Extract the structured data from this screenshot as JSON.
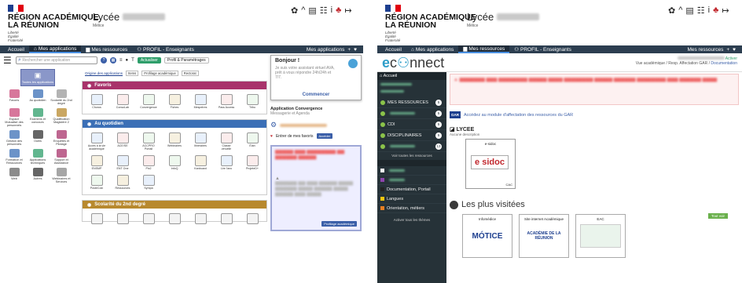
{
  "left": {
    "header": {
      "ministry": "RÉGION ACADÉMIQUE\nLA RÉUNION",
      "motto": "Liberté\nÉgalité\nFraternité",
      "school": "Lycée",
      "subtitle": "Mélice"
    },
    "nav": {
      "home": "Accueil",
      "apps": "Mes applications",
      "resources": "Mes ressources",
      "profile": "PROFIL - Enseignants",
      "right": "Mes applications"
    },
    "toolbar": {
      "search_placeholder": "Rechercher une application",
      "refresh": "Actualiser",
      "profile_settings": "Profil & Paramétrages"
    },
    "sidebar": {
      "selected": "Toutes les applications",
      "items": [
        "Favoris",
        "Au quotidien",
        "Scolarité du 2nd degré",
        "Espace Mutualisé des personnels",
        "Examens et concours",
        "Qualification Magistère 2",
        "Gestion des personnels",
        "Outils",
        "Enquêtes et Pilotage",
        "Formation et Ressources",
        "Applications techniques",
        "Support et Assistance",
        "Web",
        "Autres",
        "Webinaires et Services"
      ]
    },
    "origin": {
      "label": "Origine des applications",
      "chips": [
        "Items",
        "Profilage académique",
        "Rectorat"
      ]
    },
    "sections": [
      {
        "title": "Favoris",
        "color": "#a8336b",
        "apps": [
          "Chorus",
          "ConsoLab",
          "Convergence",
          "Fiches",
          "Mespetres",
          "Pass Access",
          "Tribu"
        ]
      },
      {
        "title": "Au quotidien",
        "color": "#3b6fb6",
        "apps": [
          "Accès à la vie académique",
          "ACE/SE",
          "ACCPRO Portail",
          "Webinaires",
          "Itinéraires",
          "Classe virtuelle",
          "Élan",
          "ENSMP",
          "ENT One",
          "Pix2",
          "InfoQ",
          "Kanboard",
          "Lire l'anc",
          "ProjeteD+",
          "PosteCoin",
          "Ressources",
          "Sympa"
        ]
      },
      {
        "title": "Scolarité du 2nd degré",
        "color": "#b8892e",
        "apps": []
      }
    ],
    "assistant": {
      "title": "Bonjour !",
      "text": "Je suis votre assistant virtuel AVA, prêt à vous répondre 24h/24h et 7/7.",
      "cta": "Commencer"
    },
    "convergence": {
      "title": "Application Convergence",
      "subtitle": "Messagerie et Agenda",
      "link": "Entrer de mes favoris",
      "btn": "Accéder"
    },
    "notice_btn": "Profilage académique"
  },
  "right": {
    "header": {
      "ministry": "RÉGION ACADÉMIQUE\nLA RÉUNION",
      "school": "Lycée",
      "subtitle": "Mélice"
    },
    "nav": {
      "home": "Accueil",
      "apps": "Mes applications",
      "resources": "Mes ressources",
      "profile": "PROFIL - Enseignants",
      "right": "Mes ressources"
    },
    "topinfo": {
      "activate": "Activer",
      "line": "Vue académique / Resp. Affectation GAR /",
      "doc": "Documentation"
    },
    "sidebar": {
      "home": "Accueil",
      "items": [
        {
          "label": "MES RESSOURCES",
          "count": "5"
        },
        {
          "label": "",
          "count": "5"
        },
        {
          "label": "CDI",
          "count": "5"
        },
        {
          "label": "DISCIPLINAIRES",
          "count": "5"
        },
        {
          "label": "",
          "count": "13"
        }
      ],
      "see_all": "Voir toutes les ressources",
      "themes": [
        "",
        "",
        "Documentation, Portail",
        "Langues",
        "Orientation, métiers"
      ],
      "see_themes": "Activer tous les thèmes"
    },
    "gar": {
      "logo": "GAR",
      "text": "Accédez au module d'affectation des ressources du GAR"
    },
    "lycee": {
      "title": "LYCEE",
      "desc": "Aucune description",
      "card_label": "e-sidoc",
      "card_logo": "e sidoc",
      "card_code": "CAC"
    },
    "visited": {
      "title": "Les plus visitées",
      "more": "Tout voir",
      "cards": [
        {
          "label": "Infomédice",
          "logo": "MÓTICE"
        },
        {
          "label": "Site internet Académique",
          "logo": "ACADÉMIE DE LA RÉUNION"
        },
        {
          "label": "EAC",
          "logo": ""
        }
      ]
    }
  }
}
